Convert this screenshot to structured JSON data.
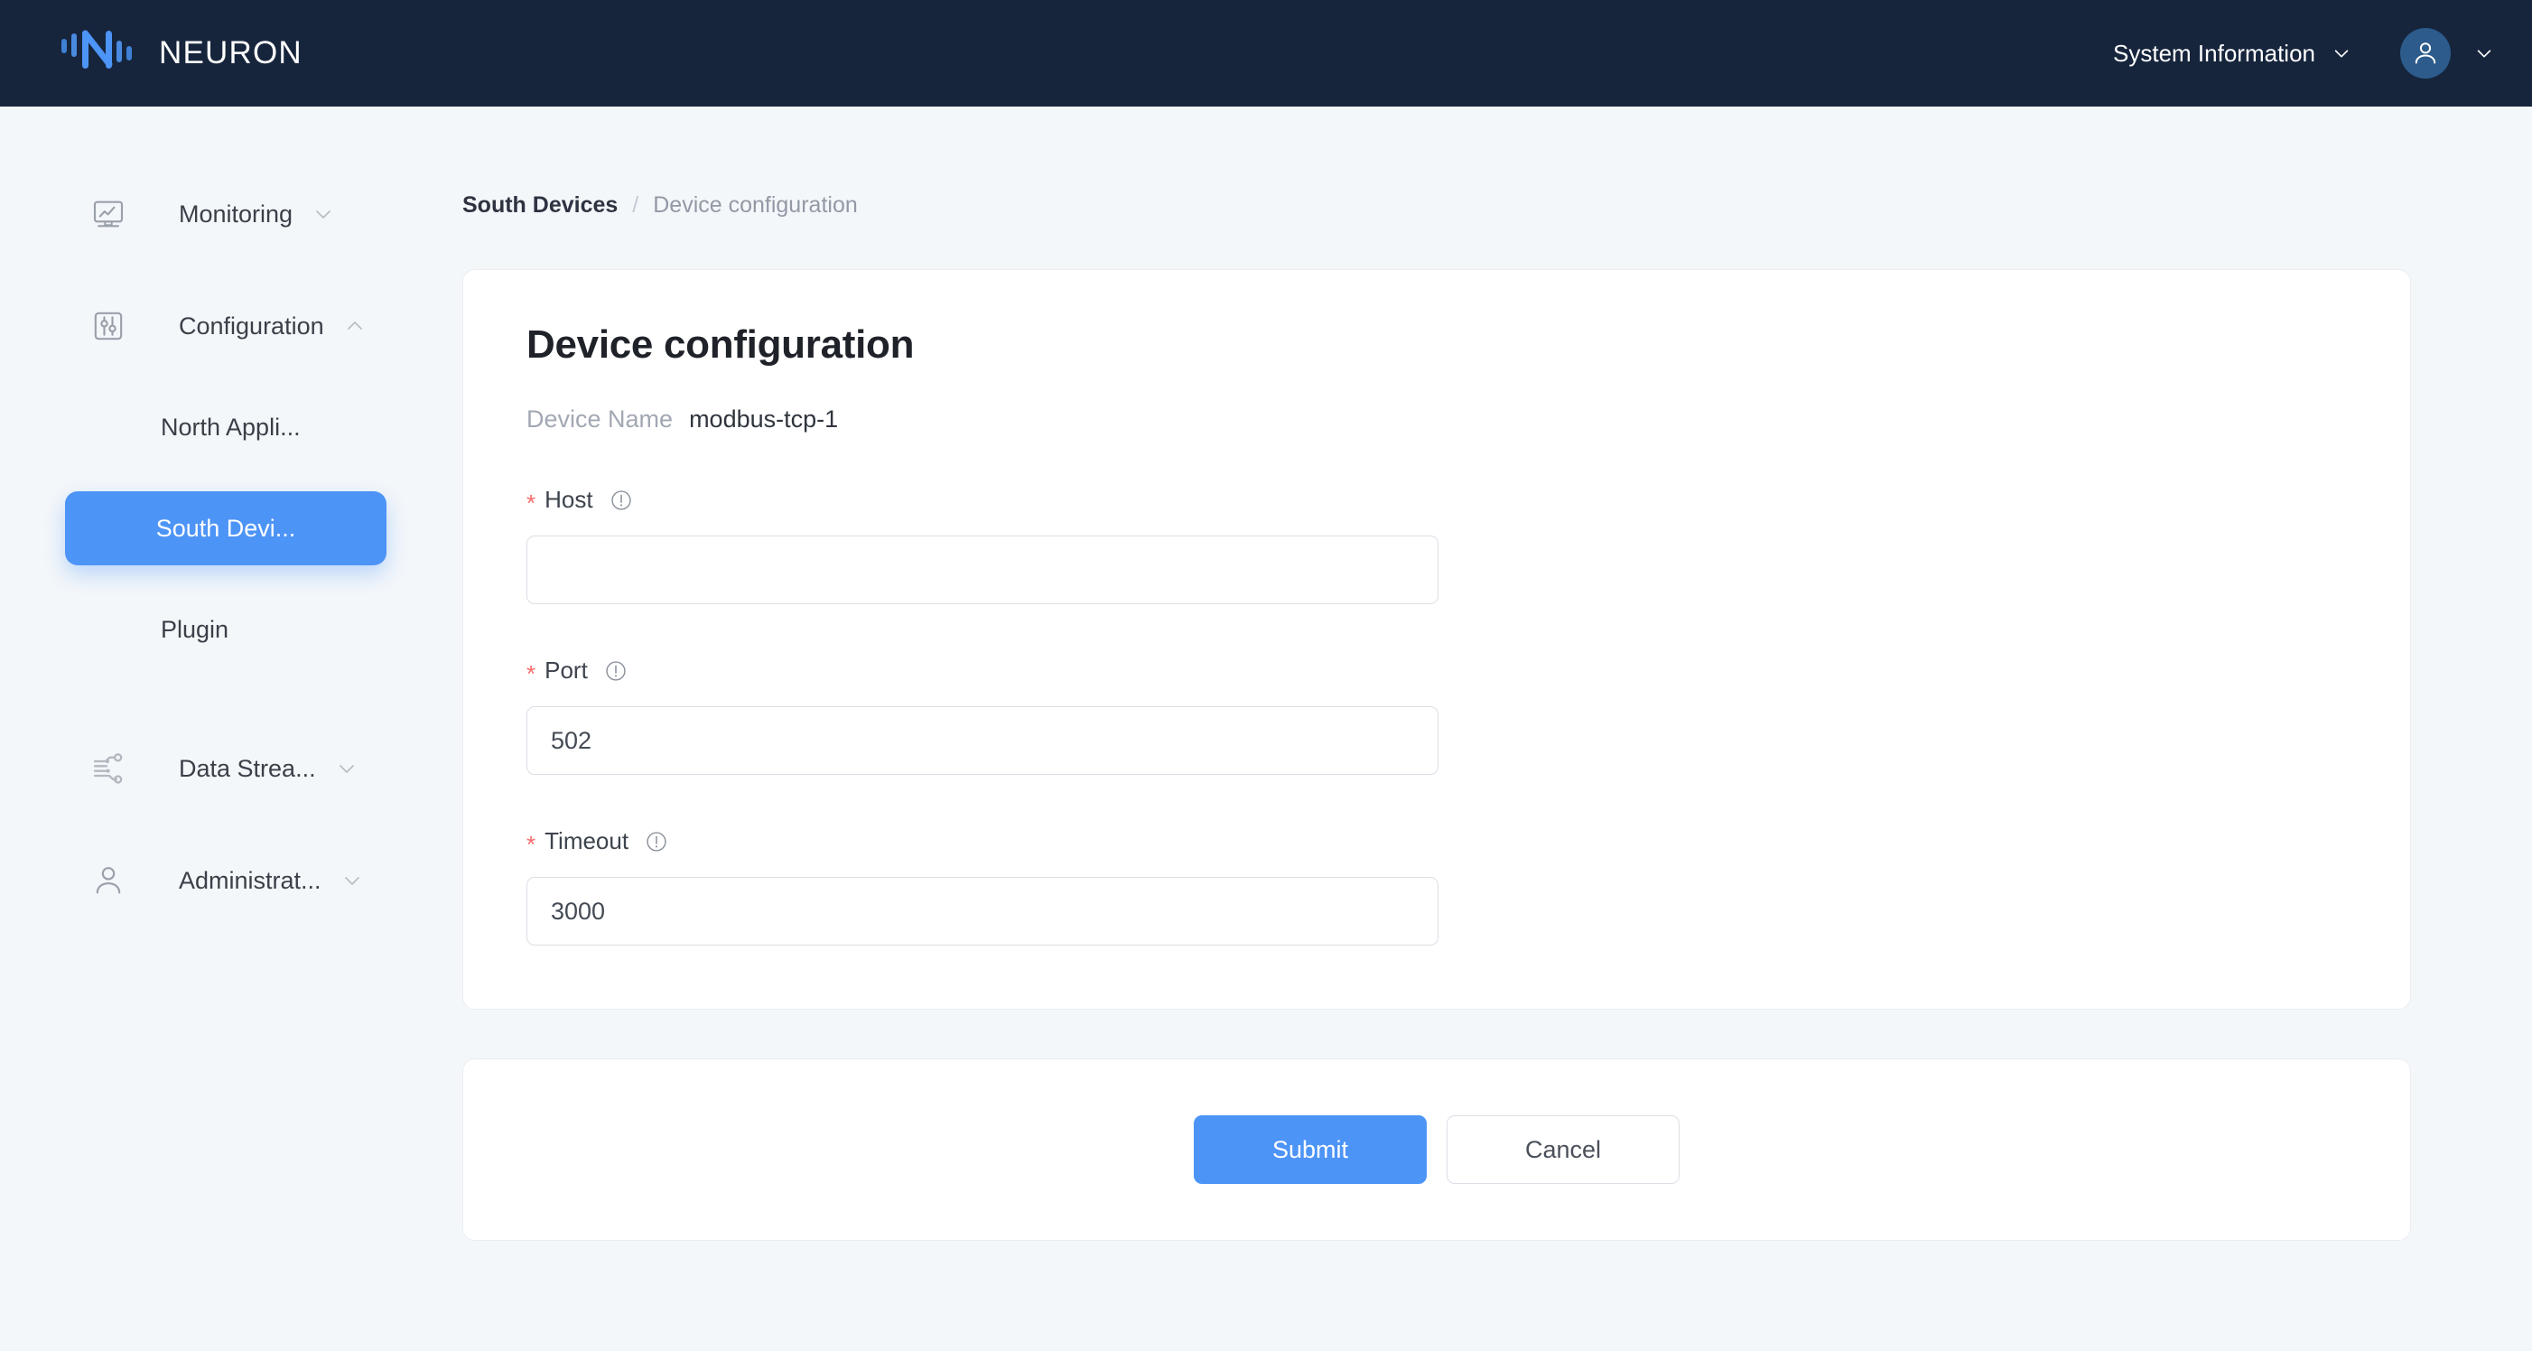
{
  "header": {
    "brand": "NEURON",
    "logo_icon": "neuron-logo-icon",
    "system_information_label": "System Information",
    "system_information_chevron": "chevron-down-icon",
    "avatar_icon": "user-avatar-icon",
    "avatar_chevron": "chevron-down-icon",
    "bg_color": "#16253c",
    "brand_accent": "#4d94f7"
  },
  "sidebar": {
    "items": [
      {
        "label": "Monitoring",
        "icon": "monitor-chart-icon",
        "arrow": "chevron-down-icon",
        "expanded": false
      },
      {
        "label": "Configuration",
        "icon": "sliders-icon",
        "arrow": "chevron-up-icon",
        "expanded": true
      },
      {
        "label": "Data Strea...",
        "icon": "data-stream-icon",
        "arrow": "chevron-down-icon",
        "expanded": false
      },
      {
        "label": "Administrat...",
        "icon": "user-icon",
        "arrow": "chevron-down-icon",
        "expanded": false
      }
    ],
    "sub_items": [
      {
        "label": "North Appli...",
        "active": false
      },
      {
        "label": "South Devi...",
        "active": true
      },
      {
        "label": "Plugin",
        "active": false
      }
    ],
    "active_color": "#4d94f7"
  },
  "breadcrumb": {
    "root": "South Devices",
    "separator": "/",
    "current": "Device configuration"
  },
  "form": {
    "title": "Device configuration",
    "device_name_label": "Device Name",
    "device_name_value": "modbus-tcp-1",
    "required_marker": "*",
    "info_icon": "info-circle-icon",
    "fields": [
      {
        "label": "Host",
        "value": "",
        "placeholder": "",
        "required": true
      },
      {
        "label": "Port",
        "value": "502",
        "placeholder": "",
        "required": true
      },
      {
        "label": "Timeout",
        "value": "3000",
        "placeholder": "",
        "required": true
      }
    ]
  },
  "footer": {
    "submit_label": "Submit",
    "cancel_label": "Cancel",
    "submit_color": "#4d94f7"
  }
}
